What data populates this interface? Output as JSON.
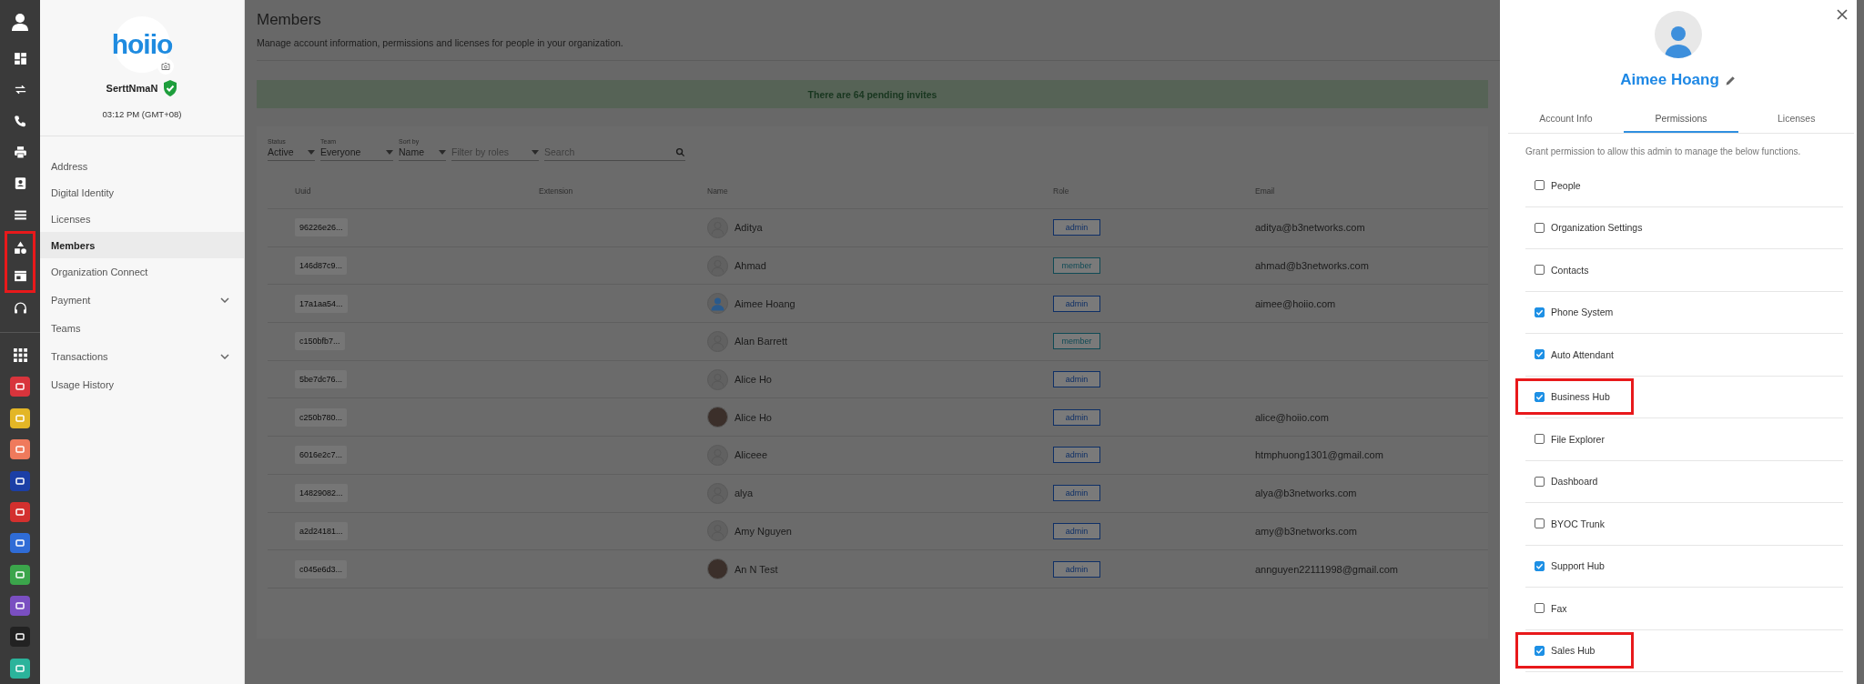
{
  "rail": {
    "nav": [
      {
        "highlighted": false
      },
      {
        "highlighted": false
      },
      {
        "highlighted": false
      },
      {
        "highlighted": false
      },
      {
        "highlighted": false
      },
      {
        "highlighted": false
      },
      {
        "highlighted": false
      },
      {
        "highlighted": true
      },
      {
        "highlighted": true
      },
      {
        "highlighted": false
      }
    ],
    "apps": [
      {
        "color": "#d8343c"
      },
      {
        "color": "#e3b626"
      },
      {
        "color": "#ef7a5c"
      },
      {
        "color": "#1b3fa6"
      },
      {
        "color": "#d3302e"
      },
      {
        "color": "#2f6cd6"
      },
      {
        "color": "#3ba54b"
      },
      {
        "color": "#7a4fc1"
      },
      {
        "color": "#222222"
      },
      {
        "color": "#2bb39b"
      }
    ]
  },
  "sidebar": {
    "logo": "hoiio",
    "org_name": "SerttNmaN",
    "verified": true,
    "time": "03:12 PM (GMT+08)",
    "items": [
      {
        "label": "Address",
        "selected": false,
        "expandable": false
      },
      {
        "label": "Digital Identity",
        "selected": false,
        "expandable": false
      },
      {
        "label": "Licenses",
        "selected": false,
        "expandable": false
      },
      {
        "label": "Members",
        "selected": true,
        "expandable": false
      },
      {
        "label": "Organization Connect",
        "selected": false,
        "expandable": false
      },
      {
        "label": "Payment",
        "selected": false,
        "expandable": true
      },
      {
        "label": "Teams",
        "selected": false,
        "expandable": false
      },
      {
        "label": "Transactions",
        "selected": false,
        "expandable": true
      },
      {
        "label": "Usage History",
        "selected": false,
        "expandable": false
      }
    ]
  },
  "main": {
    "title": "Members",
    "subtitle": "Manage account information, permissions and licenses for people in your organization.",
    "banner": "There are 64 pending invites",
    "filters": [
      {
        "label": "Status",
        "value": "Active"
      },
      {
        "label": "Team",
        "value": "Everyone"
      },
      {
        "label": "Sort by",
        "value": "Name"
      }
    ],
    "role_filter": {
      "placeholder": "Filter by roles"
    },
    "search": {
      "placeholder": "Search"
    },
    "table": {
      "columns": [
        "Uuid",
        "Extension",
        "Name",
        "Role",
        "Email"
      ],
      "rows": [
        {
          "uuid": "96226e26...",
          "name": "Aditya",
          "kind": "default",
          "role": {
            "text": "admin",
            "color": "#0e2f66"
          },
          "email": "aditya@b3networks.com"
        },
        {
          "uuid": "146d87c9...",
          "name": "Ahmad",
          "kind": "default",
          "role": {
            "text": "member",
            "color": "#0f4a55"
          },
          "email": "ahmad@b3networks.com"
        },
        {
          "uuid": "17a1aa54...",
          "name": "Aimee Hoang",
          "kind": "person",
          "role": {
            "text": "admin",
            "color": "#0e2f66"
          },
          "email": "aimee@hoiio.com"
        },
        {
          "uuid": "c150bfb7...",
          "name": "Alan Barrett",
          "kind": "default",
          "role": {
            "text": "member",
            "color": "#0f4a55"
          }
        },
        {
          "uuid": "5be7dc76...",
          "name": "Alice Ho",
          "kind": "default",
          "role": {
            "text": "admin",
            "color": "#0e2f66"
          }
        },
        {
          "uuid": "c250b780...",
          "name": "Alice Ho",
          "kind": "photo",
          "role": {
            "text": "admin",
            "color": "#0e2f66"
          },
          "email": "alice@hoiio.com"
        },
        {
          "uuid": "6016e2c7...",
          "name": "Aliceee",
          "kind": "default",
          "role": {
            "text": "admin",
            "color": "#0e2f66"
          },
          "email": "htmphuong1301@gmail.com"
        },
        {
          "uuid": "14829082...",
          "name": "alya",
          "kind": "default",
          "role": {
            "text": "admin",
            "color": "#0e2f66"
          },
          "email": "alya@b3networks.com"
        },
        {
          "uuid": "a2d24181...",
          "name": "Amy Nguyen",
          "kind": "default",
          "role": {
            "text": "admin",
            "color": "#0e2f66"
          },
          "email": "amy@b3networks.com"
        },
        {
          "uuid": "c045e6d3...",
          "name": "An N Test",
          "kind": "photo",
          "role": {
            "text": "admin",
            "color": "#0e2f66"
          },
          "email": "annguyen22111998@gmail.com"
        }
      ]
    }
  },
  "panel": {
    "name": "Aimee Hoang",
    "tabs": [
      {
        "label": "Account Info",
        "selected": false
      },
      {
        "label": "Permissions",
        "selected": true
      },
      {
        "label": "Licenses",
        "selected": false
      }
    ],
    "description": "Grant permission to allow this admin to manage the below functions.",
    "permissions": [
      {
        "label": "People",
        "checked": false,
        "highlighted": false
      },
      {
        "label": "Organization Settings",
        "checked": false,
        "highlighted": false
      },
      {
        "label": "Contacts",
        "checked": false,
        "highlighted": false
      },
      {
        "label": "Phone System",
        "checked": true,
        "highlighted": false
      },
      {
        "label": "Auto Attendant",
        "checked": true,
        "highlighted": false
      },
      {
        "label": "Business Hub",
        "checked": true,
        "highlighted": true
      },
      {
        "label": "File Explorer",
        "checked": false,
        "highlighted": false
      },
      {
        "label": "Dashboard",
        "checked": false,
        "highlighted": false
      },
      {
        "label": "BYOC Trunk",
        "checked": false,
        "highlighted": false
      },
      {
        "label": "Support Hub",
        "checked": true,
        "highlighted": false
      },
      {
        "label": "Fax",
        "checked": false,
        "highlighted": false
      },
      {
        "label": "Sales Hub",
        "checked": true,
        "highlighted": true
      }
    ]
  }
}
